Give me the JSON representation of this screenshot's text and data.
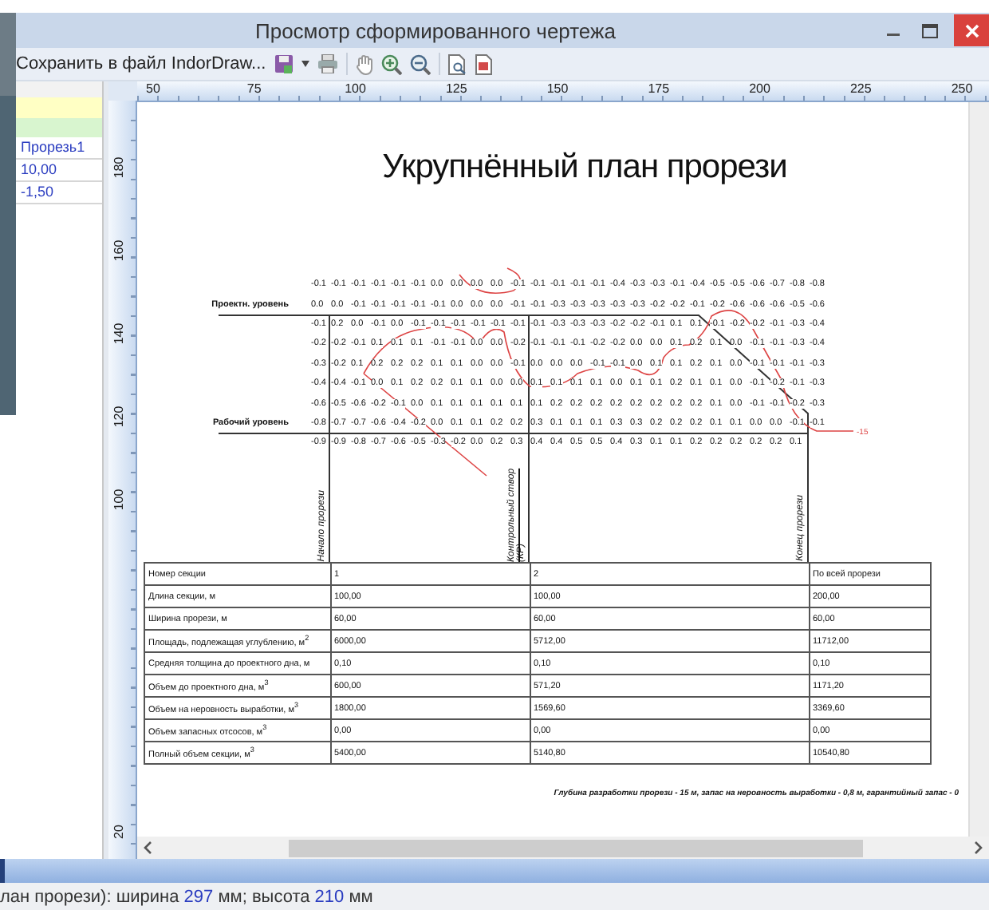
{
  "window": {
    "title": "Просмотр сформированного чертежа"
  },
  "toolbar": {
    "save_label": "Сохранить в файл IndorDraw..."
  },
  "side_panel": {
    "cells": [
      "Прорезь1",
      "10,00",
      "-1,50"
    ]
  },
  "rulers": {
    "horizontal": [
      "50",
      "75",
      "100",
      "125",
      "150",
      "175",
      "200",
      "225",
      "250"
    ],
    "vertical": [
      "180",
      "160",
      "140",
      "120",
      "100",
      "20"
    ]
  },
  "drawing": {
    "title": "Укрупнённый план прорези",
    "depth_grid": [
      {
        "values": [
          "-0.1",
          "-0.1",
          "-0.1",
          "-0.1",
          "-0.1",
          "-0.1",
          "0.0",
          "0.0",
          "0.0",
          "0.0",
          "-0.1",
          "-0.1",
          "-0.1",
          "-0.1",
          "-0.1",
          "-0.4",
          "-0.3",
          "-0.3",
          "-0.1",
          "-0.4",
          "-0.5",
          "-0.5",
          "-0.6",
          "-0.7",
          "-0.8",
          "-0.8"
        ]
      },
      {
        "label": "Проектн. уровень",
        "values": [
          "0.0",
          "0.0",
          "-0.1",
          "-0.1",
          "-0.1",
          "-0.1",
          "-0.1",
          "0.0",
          "0.0",
          "0.0",
          "-0.1",
          "-0.1",
          "-0.3",
          "-0.3",
          "-0.3",
          "-0.3",
          "-0.3",
          "-0.2",
          "-0.2",
          "-0.1",
          "-0.2",
          "-0.6",
          "-0.6",
          "-0.6",
          "-0.5",
          "-0.6"
        ]
      },
      {
        "values": [
          "-0.1",
          "0.2",
          "0.0",
          "-0.1",
          "0.0",
          "-0.1",
          "-0.1",
          "-0.1",
          "-0.1",
          "-0.1",
          "-0.1",
          "-0.1",
          "-0.3",
          "-0.3",
          "-0.3",
          "-0.2",
          "-0.2",
          "-0.1",
          "0.1",
          "0.1",
          "-0.1",
          "-0.2",
          "-0.2",
          "-0.1",
          "-0.3",
          "-0.4"
        ]
      },
      {
        "values": [
          "-0.2",
          "-0.2",
          "-0.1",
          "0.1",
          "0.1",
          "0.1",
          "-0.1",
          "-0.1",
          "0.0",
          "0.0",
          "-0.2",
          "-0.1",
          "-0.1",
          "-0.1",
          "-0.2",
          "-0.2",
          "0.0",
          "0.0",
          "0.1",
          "0.2",
          "0.1",
          "0.0",
          "-0.1",
          "-0.1",
          "-0.3",
          "-0.4"
        ]
      },
      {
        "values": [
          "-0.3",
          "-0.2",
          "0.1",
          "0.2",
          "0.2",
          "0.2",
          "0.1",
          "0.1",
          "0.0",
          "0.0",
          "-0.1",
          "0.0",
          "0.0",
          "0.0",
          "-0.1",
          "-0.1",
          "0.0",
          "0.1",
          "0.1",
          "0.2",
          "0.1",
          "0.0",
          "-0.1",
          "-0.1",
          "-0.1",
          "-0.3"
        ]
      },
      {
        "values": [
          "-0.4",
          "-0.4",
          "-0.1",
          "0.0",
          "0.1",
          "0.2",
          "0.2",
          "0.1",
          "0.1",
          "0.0",
          "0.0",
          "0.1",
          "0.1",
          "0.1",
          "0.1",
          "0.0",
          "0.1",
          "0.1",
          "0.2",
          "0.1",
          "0.1",
          "0.0",
          "-0.1",
          "-0.2",
          "-0.1",
          "-0.3"
        ]
      },
      {
        "values": [
          "-0.6",
          "-0.5",
          "-0.6",
          "-0.2",
          "-0.1",
          "0.0",
          "0.1",
          "0.1",
          "0.1",
          "0.1",
          "0.1",
          "0.1",
          "0.2",
          "0.2",
          "0.2",
          "0.2",
          "0.2",
          "0.2",
          "0.2",
          "0.2",
          "0.1",
          "0.0",
          "-0.1",
          "-0.1",
          "-0.2",
          "-0.3"
        ]
      },
      {
        "label": "Рабочий уровень",
        "values": [
          "-0.8",
          "-0.7",
          "-0.7",
          "-0.6",
          "-0.4",
          "-0.2",
          "0.0",
          "0.1",
          "0.1",
          "0.2",
          "0.2",
          "0.3",
          "0.1",
          "0.1",
          "0.1",
          "0.3",
          "0.3",
          "0.2",
          "0.2",
          "0.2",
          "0.1",
          "0.1",
          "0.0",
          "0.0",
          "-0.1",
          "-0.1"
        ]
      },
      {
        "values": [
          "-0.9",
          "-0.9",
          "-0.8",
          "-0.7",
          "-0.6",
          "-0.5",
          "-0.3",
          "-0.2",
          "0.0",
          "0.2",
          "0.3",
          "0.4",
          "0.4",
          "0.5",
          "0.5",
          "0.4",
          "0.3",
          "0.1",
          "0.1",
          "0.2",
          "0.2",
          "0.2",
          "0.2",
          "0.2",
          "0.1"
        ]
      }
    ],
    "contour_label": "-15",
    "section_marks": [
      "Начало прорези",
      "Контрольный створ (КР)",
      "Конец прорези"
    ],
    "table": {
      "rows": [
        {
          "label": "Номер секции",
          "values": [
            "1",
            "2",
            "По всей прорези"
          ]
        },
        {
          "label": "Длина секции, м",
          "values": [
            "100,00",
            "100,00",
            "200,00"
          ]
        },
        {
          "label": "Ширина прорези, м",
          "values": [
            "60,00",
            "60,00",
            "60,00"
          ]
        },
        {
          "label": "Площадь, подлежащая углублению, м$^{2}$",
          "values": [
            "6000,00",
            "5712,00",
            "11712,00"
          ]
        },
        {
          "label": "Средняя толщина до проектного дна, м",
          "values": [
            "0,10",
            "0,10",
            "0,10"
          ]
        },
        {
          "label": "Объем до проектного дна, м$^{3}$",
          "values": [
            "600,00",
            "571,20",
            "1171,20"
          ]
        },
        {
          "label": "Объем на неровность выработки, м$^{3}$",
          "values": [
            "1800,00",
            "1569,60",
            "3369,60"
          ]
        },
        {
          "label": "Объем запасных отсосов, м$^{3}$",
          "values": [
            "0,00",
            "0,00",
            "0,00"
          ]
        },
        {
          "label": "Полный объем секции, м$^{3}$",
          "values": [
            "5400,00",
            "5140,80",
            "10540,80"
          ]
        }
      ]
    },
    "footnote": "Глубина разработки прорези - 15 м, запас на неровность выработки - 0,8 м, гарантийный запас - 0"
  },
  "status_bar": {
    "segments": [
      {
        "kind": "label",
        "text": "лан прорези): ширина "
      },
      {
        "kind": "value",
        "text": "297"
      },
      {
        "kind": "label",
        "text": " мм; высота "
      },
      {
        "kind": "value",
        "text": "210"
      },
      {
        "kind": "label",
        "text": " мм"
      }
    ]
  }
}
